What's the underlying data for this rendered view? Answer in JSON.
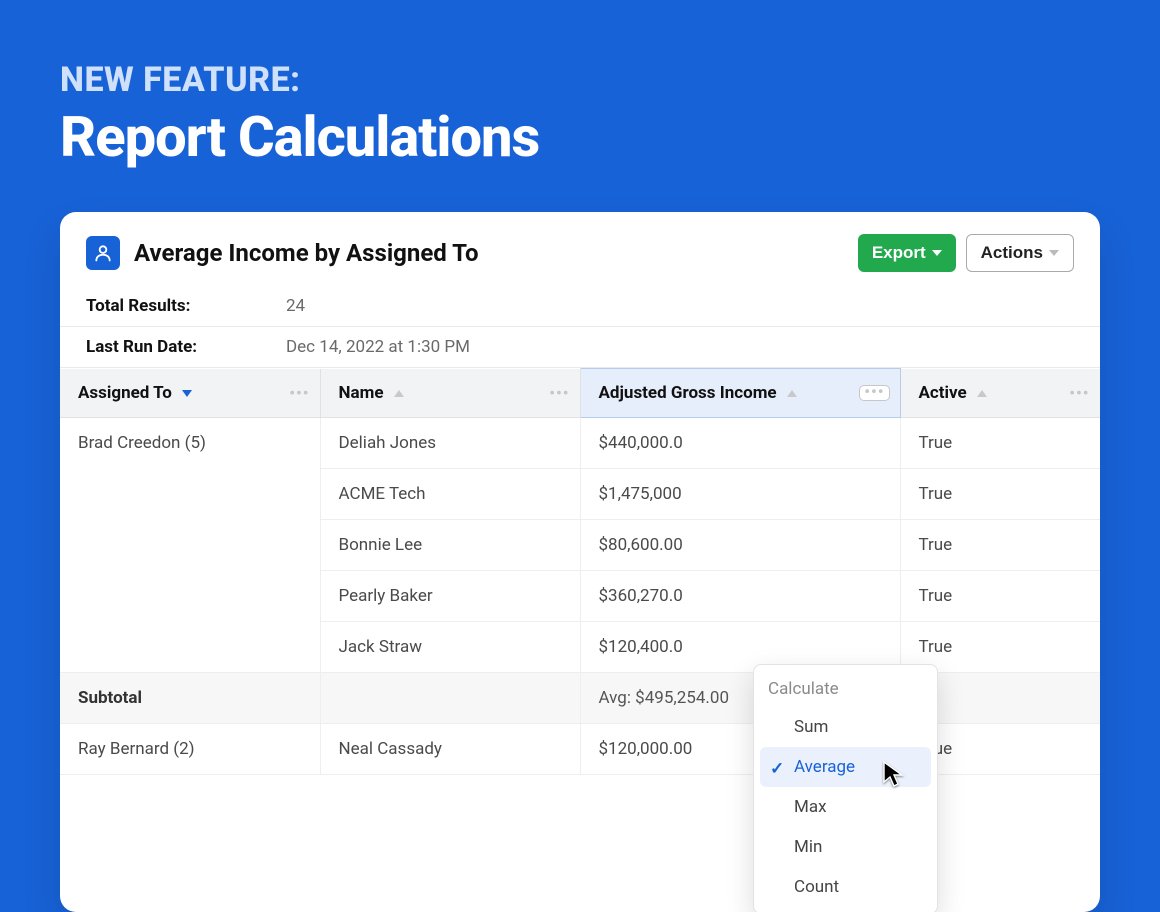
{
  "banner": {
    "eyebrow": "NEW FEATURE:",
    "headline": "Report Calculations"
  },
  "report": {
    "title": "Average Income by Assigned To",
    "buttons": {
      "export": "Export",
      "actions": "Actions"
    },
    "meta": {
      "total_label": "Total Results:",
      "total_value": "24",
      "last_run_label": "Last Run Date:",
      "last_run_value": "Dec 14, 2022 at 1:30 PM"
    },
    "columns": {
      "assigned": "Assigned To",
      "name": "Name",
      "income": "Adjusted Gross Income",
      "active": "Active"
    },
    "groups": [
      {
        "group_label": "Brad Creedon (5)",
        "rows": [
          {
            "name": "Deliah Jones",
            "income": "$440,000.0",
            "active": "True"
          },
          {
            "name": "ACME Tech",
            "income": "$1,475,000",
            "active": "True"
          },
          {
            "name": "Bonnie Lee",
            "income": "$80,600.00",
            "active": "True"
          },
          {
            "name": "Pearly Baker",
            "income": "$360,270.0",
            "active": "True"
          },
          {
            "name": "Jack Straw",
            "income": "$120,400.0",
            "active": "True"
          }
        ],
        "subtotal_label": "Subtotal",
        "subtotal_income": "Avg: $495,254.00"
      },
      {
        "group_label": "Ray Bernard (2)",
        "rows": [
          {
            "name": "Neal Cassady",
            "income": "$120,000.00",
            "active": "True"
          }
        ]
      }
    ],
    "calc_menu": {
      "heading": "Calculate",
      "items": [
        "Sum",
        "Average",
        "Max",
        "Min",
        "Count"
      ],
      "selected_index": 1
    }
  }
}
